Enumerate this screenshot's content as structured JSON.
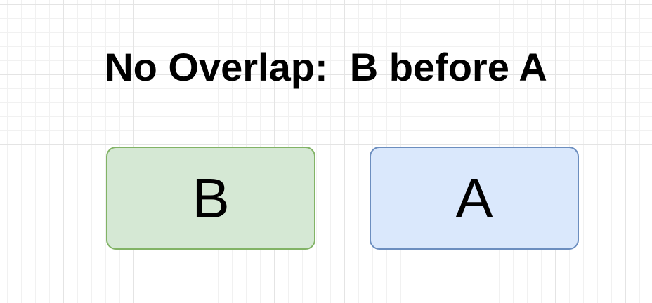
{
  "title": "No Overlap:  B before A",
  "boxes": [
    {
      "label": "B",
      "fill": "#d5e8d4",
      "stroke": "#82b366"
    },
    {
      "label": "A",
      "fill": "#dae8fc",
      "stroke": "#6c8ebf"
    }
  ]
}
